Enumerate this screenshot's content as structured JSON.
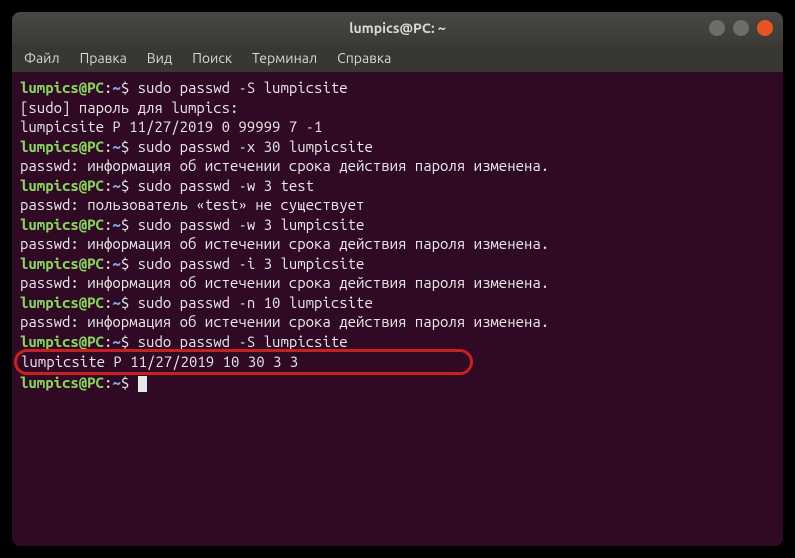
{
  "titlebar": {
    "title": "lumpics@PC: ~"
  },
  "menu": {
    "file": "Файл",
    "edit": "Правка",
    "view": "Вид",
    "search": "Поиск",
    "terminal": "Терминал",
    "help": "Справка"
  },
  "prompt": {
    "user_host": "lumpics@PC",
    "path": "~",
    "sep": ":",
    "sigil": "$"
  },
  "lines": [
    {
      "type": "prompt",
      "cmd": "sudo passwd -S lumpicsite"
    },
    {
      "type": "out",
      "text": "[sudo] пароль для lumpics:"
    },
    {
      "type": "out",
      "text": "lumpicsite P 11/27/2019 0 99999 7 -1"
    },
    {
      "type": "prompt",
      "cmd": "sudo passwd -x 30 lumpicsite"
    },
    {
      "type": "out",
      "text": "passwd: информация об истечении срока действия пароля изменена."
    },
    {
      "type": "prompt",
      "cmd": "sudo passwd -w 3 test"
    },
    {
      "type": "out",
      "text": "passwd: пользователь «test» не существует"
    },
    {
      "type": "prompt",
      "cmd": "sudo passwd -w 3 lumpicsite"
    },
    {
      "type": "out",
      "text": "passwd: информация об истечении срока действия пароля изменена."
    },
    {
      "type": "prompt",
      "cmd": "sudo passwd -i 3 lumpicsite"
    },
    {
      "type": "out",
      "text": "passwd: информация об истечении срока действия пароля изменена."
    },
    {
      "type": "prompt",
      "cmd": "sudo passwd -n 10 lumpicsite"
    },
    {
      "type": "out",
      "text": "passwd: информация об истечении срока действия пароля изменена."
    },
    {
      "type": "prompt",
      "cmd": "sudo passwd -S lumpicsite"
    },
    {
      "type": "highlight",
      "text": "lumpicsite P 11/27/2019 10 30 3 3"
    },
    {
      "type": "prompt",
      "cmd": ""
    }
  ]
}
